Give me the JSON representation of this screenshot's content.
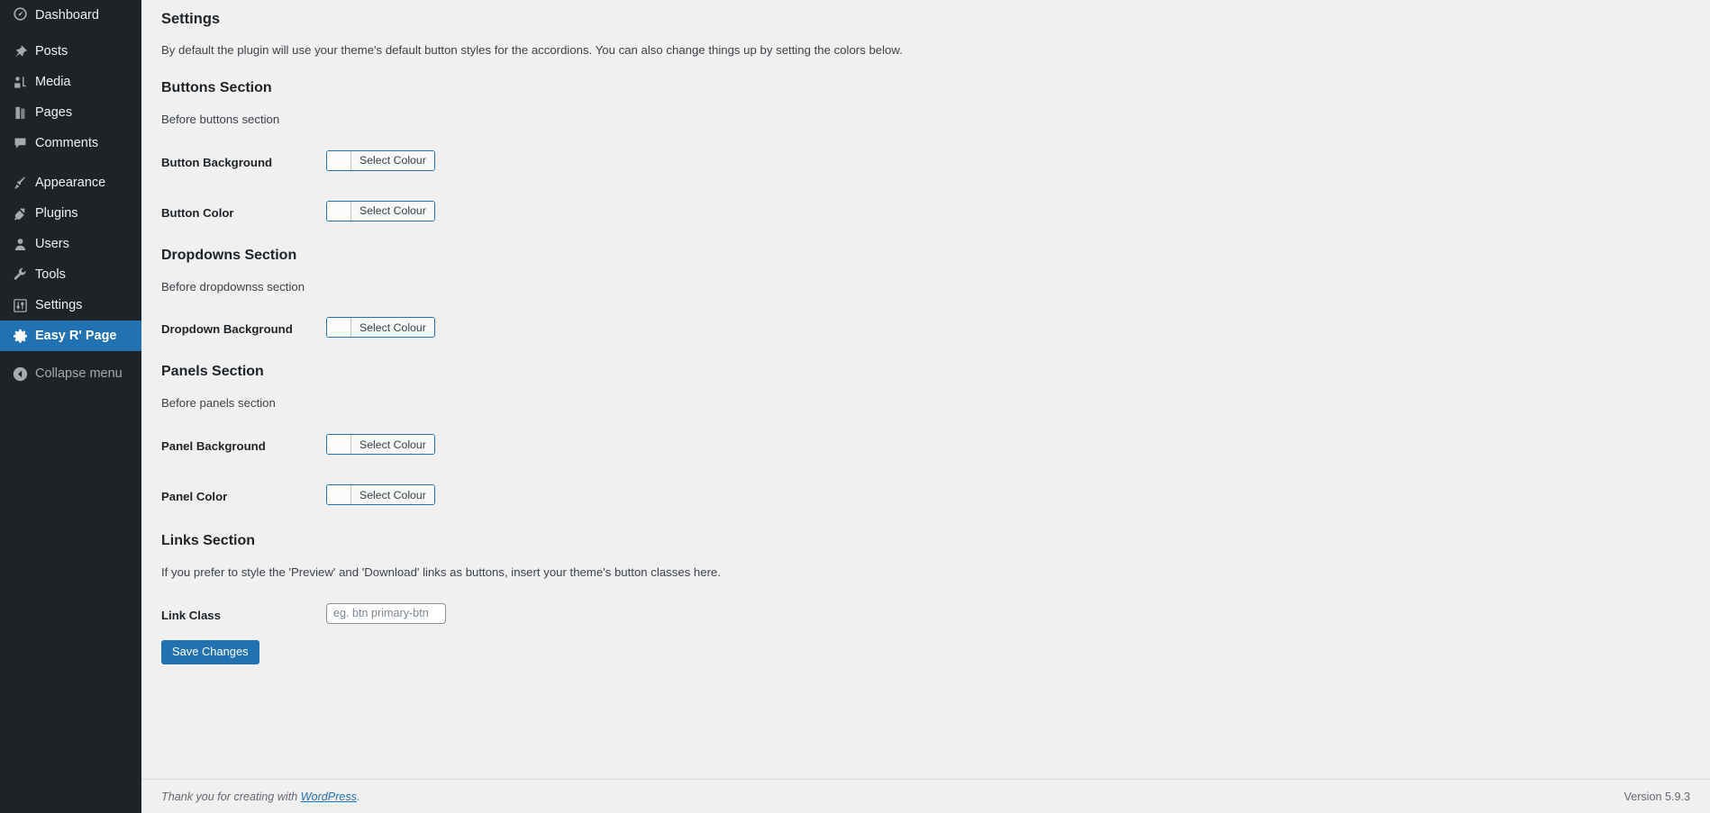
{
  "sidebar": {
    "items": [
      {
        "label": "Dashboard",
        "icon": "dashboard-icon",
        "active": false
      },
      {
        "label": "Posts",
        "icon": "pin-icon",
        "active": false
      },
      {
        "label": "Media",
        "icon": "media-icon",
        "active": false
      },
      {
        "label": "Pages",
        "icon": "pages-icon",
        "active": false
      },
      {
        "label": "Comments",
        "icon": "comments-icon",
        "active": false
      },
      {
        "label": "Appearance",
        "icon": "brush-icon",
        "active": false
      },
      {
        "label": "Plugins",
        "icon": "plugin-icon",
        "active": false
      },
      {
        "label": "Users",
        "icon": "user-icon",
        "active": false
      },
      {
        "label": "Tools",
        "icon": "wrench-icon",
        "active": false
      },
      {
        "label": "Settings",
        "icon": "sliders-icon",
        "active": false
      },
      {
        "label": "Easy R' Page",
        "icon": "gear-icon",
        "active": true
      }
    ],
    "collapse_label": "Collapse menu",
    "collapse_icon": "chevron-left-circle-icon",
    "active_color": "#2271b1",
    "background_color": "#1d2327"
  },
  "page": {
    "title": "Settings",
    "intro": "By default the plugin will use your theme's default button styles for the accordions. You can also change things up by setting the colors below."
  },
  "sections": [
    {
      "title": "Buttons Section",
      "description": "Before buttons section",
      "fields": [
        {
          "label": "Button Background",
          "control": "color",
          "button_label": "Select Colour",
          "swatch_color": "#fbfbfc"
        },
        {
          "label": "Button Color",
          "control": "color",
          "button_label": "Select Colour",
          "swatch_color": "#fbfbfc"
        }
      ]
    },
    {
      "title": "Dropdowns Section",
      "description": "Before dropdownss section",
      "fields": [
        {
          "label": "Dropdown Background",
          "control": "color",
          "button_label": "Select Colour",
          "swatch_color": "#fbfbfc"
        }
      ]
    },
    {
      "title": "Panels Section",
      "description": "Before panels section",
      "fields": [
        {
          "label": "Panel Background",
          "control": "color",
          "button_label": "Select Colour",
          "swatch_color": "#fbfbfc"
        },
        {
          "label": "Panel Color",
          "control": "color",
          "button_label": "Select Colour",
          "swatch_color": "#fbfbfc"
        }
      ]
    },
    {
      "title": "Links Section",
      "description": "If you prefer to style the 'Preview' and 'Download' links as buttons, insert your theme's button classes here.",
      "fields": [
        {
          "label": "Link Class",
          "control": "text",
          "value": "",
          "placeholder": "eg. btn primary-btn"
        }
      ]
    }
  ],
  "submit": {
    "label": "Save Changes",
    "color": "#2271b1"
  },
  "footer": {
    "thanks_prefix": "Thank you for creating with ",
    "thanks_link": "WordPress",
    "thanks_suffix": ".",
    "version": "Version 5.9.3"
  }
}
